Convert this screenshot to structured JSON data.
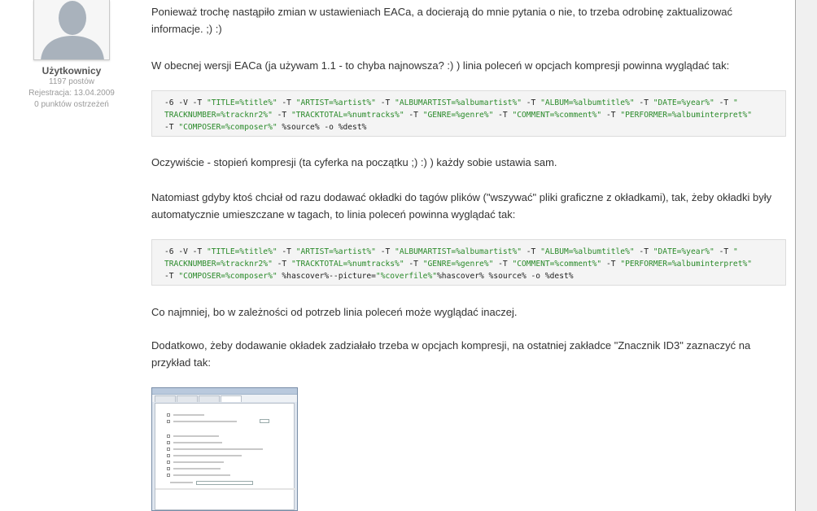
{
  "user": {
    "name": "Użytkownicy",
    "posts": "1197 postów",
    "registered": "Rejestracja: 13.04.2009",
    "warnings": "0 punktów ostrzeżeń",
    "avatar_icon": "default-avatar-icon"
  },
  "post": {
    "p1": "Ponieważ trochę nastąpiło zmian w ustawieniach EACa, a docierają do mnie pytania o nie, to trzeba odrobinę zaktualizować informacje. ;) :)",
    "p2": "W obecnej wersji EACa (ja używam 1.1 - to chyba najnowsza? :) ) linia poleceń w opcjach kompresji powinna wyglądać tak:",
    "code1": [
      [
        [
          "k",
          "-6 -V -T "
        ],
        [
          "s",
          "\"TITLE=%title%\""
        ],
        [
          "k",
          " -T "
        ],
        [
          "s",
          "\"ARTIST=%artist%\""
        ],
        [
          "k",
          " -T "
        ],
        [
          "s",
          "\"ALBUMARTIST=%albumartist%\""
        ],
        [
          "k",
          " -T "
        ],
        [
          "s",
          "\"ALBUM=%albumtitle%\""
        ],
        [
          "k",
          " -T "
        ],
        [
          "s",
          "\"DATE=%year%\""
        ],
        [
          "k",
          " -T "
        ],
        [
          "s",
          "\""
        ]
      ],
      [
        [
          "s",
          "TRACKNUMBER=%tracknr2%\""
        ],
        [
          "k",
          " -T "
        ],
        [
          "s",
          "\"TRACKTOTAL=%numtracks%\""
        ],
        [
          "k",
          " -T "
        ],
        [
          "s",
          "\"GENRE=%genre%\""
        ],
        [
          "k",
          " -T "
        ],
        [
          "s",
          "\"COMMENT=%comment%\""
        ],
        [
          "k",
          " -T "
        ],
        [
          "s",
          "\"PERFORMER=%albuminterpret%\""
        ]
      ],
      [
        [
          "k",
          "-T "
        ],
        [
          "s",
          "\"COMPOSER=%composer%\""
        ],
        [
          "k",
          " %source% -o %dest%"
        ]
      ]
    ],
    "p3": "Oczywiście - stopień kompresji (ta cyferka na początku ;) :) ) każdy sobie ustawia sam.",
    "p4": "Natomiast gdyby ktoś chciał od razu dodawać okładki do tagów plików (\"wszywać\" pliki graficzne z okładkami), tak, żeby okładki były automatycznie umieszczane w tagach, to linia poleceń powinna wyglądać tak:",
    "code2": [
      [
        [
          "k",
          "-6 -V -T "
        ],
        [
          "s",
          "\"TITLE=%title%\""
        ],
        [
          "k",
          " -T "
        ],
        [
          "s",
          "\"ARTIST=%artist%\""
        ],
        [
          "k",
          " -T "
        ],
        [
          "s",
          "\"ALBUMARTIST=%albumartist%\""
        ],
        [
          "k",
          " -T "
        ],
        [
          "s",
          "\"ALBUM=%albumtitle%\""
        ],
        [
          "k",
          " -T "
        ],
        [
          "s",
          "\"DATE=%year%\""
        ],
        [
          "k",
          " -T "
        ],
        [
          "s",
          "\""
        ]
      ],
      [
        [
          "s",
          "TRACKNUMBER=%tracknr2%\""
        ],
        [
          "k",
          " -T "
        ],
        [
          "s",
          "\"TRACKTOTAL=%numtracks%\""
        ],
        [
          "k",
          " -T "
        ],
        [
          "s",
          "\"GENRE=%genre%\""
        ],
        [
          "k",
          " -T "
        ],
        [
          "s",
          "\"COMMENT=%comment%\""
        ],
        [
          "k",
          " -T "
        ],
        [
          "s",
          "\"PERFORMER=%albuminterpret%\""
        ]
      ],
      [
        [
          "k",
          "-T "
        ],
        [
          "s",
          "\"COMPOSER=%composer%\""
        ],
        [
          "k",
          " %hascover%--picture="
        ],
        [
          "s",
          "\"%coverfile%\""
        ],
        [
          "k",
          "%hascover% %source% -o %dest%"
        ]
      ]
    ],
    "p5": "Co najmniej, bo w zależności od potrzeb linia poleceń może wyglądać inaczej.",
    "p6": "Dodatkowo, żeby dodawanie okładek zadziałało trzeba w opcjach kompresji, na ostatniej zakładce \"Znacznik ID3\" zaznaczyć na przykład tak:"
  },
  "colors": {
    "code_string": "#2a8a2a",
    "code_bg": "#f4f4f4",
    "text": "#333333"
  }
}
